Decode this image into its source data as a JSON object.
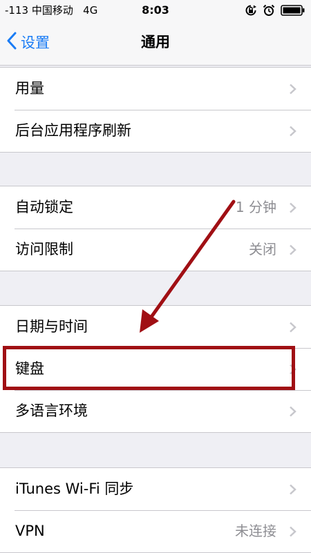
{
  "status_bar": {
    "signal": "-113",
    "carrier": "中国移动",
    "network": "4G",
    "time": "8:03"
  },
  "nav": {
    "back_label": "设置",
    "title": "通用"
  },
  "groups": [
    {
      "rows": [
        {
          "label": "用量",
          "value": ""
        },
        {
          "label": "后台应用程序刷新",
          "value": ""
        }
      ]
    },
    {
      "rows": [
        {
          "label": "自动锁定",
          "value": "1 分钟"
        },
        {
          "label": "访问限制",
          "value": "关闭"
        }
      ]
    },
    {
      "rows": [
        {
          "label": "日期与时间",
          "value": ""
        },
        {
          "label": "键盘",
          "value": ""
        },
        {
          "label": "多语言环境",
          "value": ""
        }
      ]
    },
    {
      "rows": [
        {
          "label": "iTunes Wi-Fi 同步",
          "value": ""
        },
        {
          "label": "VPN",
          "value": "未连接"
        }
      ]
    }
  ],
  "colors": {
    "accent": "#1a7cf5",
    "annotation": "#a00f14"
  },
  "icons": {
    "back": "chevron-left-icon",
    "row_disclosure": "chevron-right-icon",
    "orientation_lock": "rotation-lock-icon",
    "alarm": "alarm-clock-icon",
    "battery": "battery-icon"
  }
}
